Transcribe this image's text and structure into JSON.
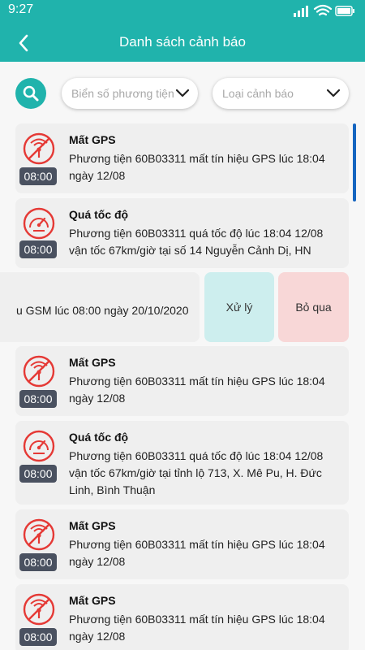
{
  "status_bar": {
    "time": "9:27"
  },
  "header": {
    "title": "Danh sách cảnh báo"
  },
  "filters": {
    "plate_placeholder": "Biển số phương tiện",
    "type_placeholder": "Loại cảnh báo"
  },
  "colors": {
    "accent": "#20b3ac",
    "alert_red": "#e53935",
    "process_bg": "#cdeeee",
    "skip_bg": "#f8d7d7",
    "time_badge": "#4a5160"
  },
  "alerts": [
    {
      "icon": "gps-off-icon",
      "time": "08:00",
      "title": "Mất GPS",
      "desc": "Phương tiện 60B03311 mất tín hiệu GPS lúc 18:04 ngày 12/08"
    },
    {
      "icon": "speedometer-icon",
      "time": "08:00",
      "title": "Quá tốc độ",
      "desc": "Phương tiện 60B03311 quá tốc độ lúc 18:04 12/08 vận tốc 67km/giờ tại số 14 Nguyễn Cảnh Dị, HN"
    },
    {
      "icon": "gps-off-icon",
      "time": "08:00",
      "title": "Mất GPS",
      "desc": "Phương tiện 60B03311 mất tín hiệu GPS lúc 18:04 ngày 12/08"
    },
    {
      "icon": "speedometer-icon",
      "time": "08:00",
      "title": "Quá tốc độ",
      "desc": "Phương tiện 60B03311 quá tốc độ lúc 18:04 12/08 vận tốc 67km/giờ tại tỉnh lộ 713, X. Mê Pu, H. Đức Linh, Bình Thuận"
    },
    {
      "icon": "gps-off-icon",
      "time": "08:00",
      "title": "Mất GPS",
      "desc": "Phương tiện 60B03311 mất tín hiệu GPS lúc 18:04 ngày 12/08"
    },
    {
      "icon": "gps-off-icon",
      "time": "08:00",
      "title": "Mất GPS",
      "desc": "Phương tiện 60B03311 mất tín hiệu GPS lúc 18:04 ngày 12/08"
    }
  ],
  "swiped_item": {
    "text": "u GSM lúc 08:00 ngày 20/10/2020",
    "process_label": "Xử lý",
    "skip_label": "Bỏ qua"
  }
}
